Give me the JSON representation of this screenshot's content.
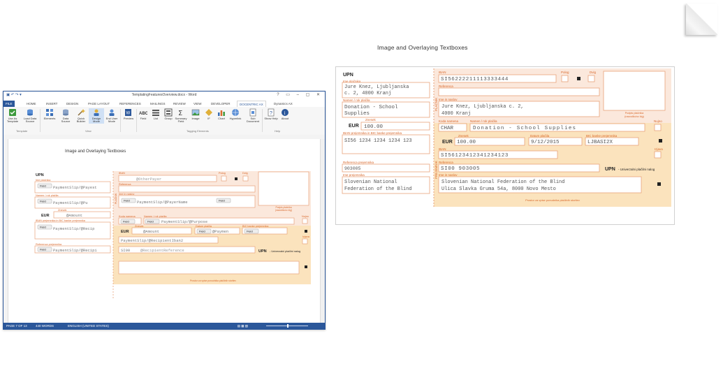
{
  "paper": {
    "title": "Image and Overlaying Textboxes",
    "left": {
      "upn": "UPN",
      "payer_label": "Ime plačnika",
      "payer_line1": "Jure Knez, Ljubljanska",
      "payer_line2": "c. 2, 4000 Kranj",
      "purpose_label": "Namen / rok plačila",
      "purpose_line1": "Donation - School",
      "purpose_line2": "Supplies",
      "amount_label": "Znesek",
      "currency": "EUR",
      "amount": "100.00",
      "iban_bic_label": "IBAN prejemnika in BIC banke prejemnika",
      "iban": "SI56 1234 1234 1234 123",
      "ref_label": "Referenca prejemnika",
      "ref": "903005",
      "recipient_label": "Ime prejemnika",
      "recipient_line1": "Slovenian National",
      "recipient_line2": "Federation of the Blind"
    },
    "right": {
      "iban_label": "IBAN",
      "payer_iban": "SI56222211113333444",
      "polog": "Polog",
      "dvig": "Dvig",
      "ref_label": "Referenca",
      "name_label": "Ime in naslov",
      "payer_line1": "Jure Knez, Ljubljanska c. 2,",
      "payer_line2": "4000 Kranj",
      "side_payer": "PLAČNIK",
      "sign_label_1": "Podpis plačnika",
      "sign_label_2": "(navodilo/ov žig)",
      "code_label": "Koda namena",
      "purpose_label": "Namen / rok plačila",
      "nujno": "Nujno",
      "code": "CHAR",
      "purpose": "Donation - School Supplies",
      "amount_label": "Znesek",
      "date_label": "Datum plačila",
      "bic_label": "BIC banke prejemnika",
      "currency": "EUR",
      "amount": "100.00",
      "date": "9/12/2015",
      "bic": "LJBASI2X",
      "recv_iban_label": "IBAN",
      "recv_iban": "SI56123412341234123",
      "izjava": "Izjava",
      "recv_ref_label": "Referenca",
      "recv_ref": "SI00 903005",
      "upn_note": "UPN",
      "upn_note_rest": "- Univerzalni plačilni nalog",
      "recv_name_label": "Ime in naslov",
      "recv_line1": "Slovenian National Federation of the Blind",
      "recv_line2": "Ulica Slavka Gruma 54a, 8000 Novo Mesto",
      "side_recipient": "PREJEMNIK",
      "footer": "Prostor za vpise ponudnika plačilnih storitev"
    }
  },
  "word": {
    "window_title": "TemplatingFeaturesOverview.docx - Word",
    "tabs": [
      "FILE",
      "HOME",
      "INSERT",
      "DESIGN",
      "PAGE LAYOUT",
      "REFERENCES",
      "MAILINGS",
      "REVIEW",
      "VIEW",
      "DEVELOPER",
      "DOCENTRIC AX",
      "Dynamics AX"
    ],
    "ribbon": {
      "use_as_template": "Use As Template",
      "load_data_source": "Load Data Source",
      "elements": "Elements",
      "data_source": "Data Source",
      "quick_builder": "Quick Builder",
      "design_mode": "Design Mode",
      "end_user_mode": "End User Mode",
      "preview": "Preview",
      "field": "Field",
      "list": "List",
      "group": "Group",
      "summary_field": "Summary Field",
      "image": "Image",
      "if": "IF",
      "chart": "Chart",
      "hyperlink": "Hyperlink",
      "sub_document": "Sub Document",
      "show_help": "Show Help",
      "about": "About",
      "group_template": "Template",
      "group_view": "View",
      "group_tagging": "Tagging Elements",
      "group_help": "Help"
    },
    "doc": {
      "title": "Image and Overlaying Textboxes",
      "upn": "UPN",
      "payer_label": "Ime plačnika",
      "payer_field": "PaymentSlip/@Payest",
      "purpose_label": "Namen / rok plačila",
      "purpose_field": "PaymentSlip/@Pu",
      "amount_label": "Znesek",
      "currency": "EUR",
      "amount_field": "@Amount",
      "iban_bic_label": "IBAN prejemnika in BIC banke prejemnika",
      "recipient_iban_field": "PaymentSlip/@Recip",
      "ref_label": "Referenca prejemnika",
      "ref_field": "PaymentSlip/@Recipi",
      "field_tag": "Field",
      "right_iban_label": "IBAN",
      "other_payer": "@OtherPayer",
      "polog": "Polog",
      "dvig": "Dvig",
      "referenca": "Referenca",
      "ime_naslov": "Ime in naslov",
      "payer_name_field": "PaymentSlip/@PayerName",
      "side_payer": "PLAČNIK",
      "sign_label_1": "Podpis plačnika",
      "sign_label_2": "(navodilo/ov žig)",
      "koda": "Koda namena",
      "namen": "Namen / rok plačila",
      "nujno": "Nujno",
      "purpose_full": "PaymentSlip/@Purpose",
      "znesek": "Znesek",
      "datum": "Datum plačila",
      "bic": "BIC banke prejemnika",
      "eur": "EUR",
      "amount2": "@Amount",
      "payment": "@Paymen",
      "recipient_iban2": "PaymentSlip/@RecipientIban2",
      "izjava": "Izjava",
      "si00": "SI00",
      "recipient_ref": "@RecipientReference",
      "upn_note": "UPN",
      "upn_note_rest": "- Univerzalni plačilni nalog",
      "footer": "Prostor za vpise ponudnika plačilnih storitev"
    },
    "status": {
      "page": "PAGE 7 OF 13",
      "words": "440 WORDS",
      "language": "ENGLISH (UNITED STATES)"
    }
  },
  "colors": {
    "form_border": "#e8a27a",
    "form_label": "#d8672a",
    "form_text": "#555555",
    "upper_band": "#fbe8dc",
    "lower_band": "#fbe3bd",
    "word_accent": "#2b579a"
  }
}
